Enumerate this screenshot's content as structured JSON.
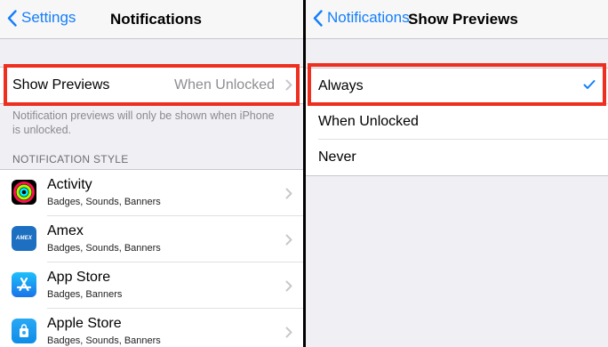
{
  "left": {
    "nav": {
      "back_label": "Settings",
      "title": "Notifications"
    },
    "show_previews": {
      "label": "Show Previews",
      "value": "When Unlocked"
    },
    "note": "Notification previews will only be shown when iPhone is unlocked.",
    "section_header": "NOTIFICATION STYLE",
    "apps": [
      {
        "name": "Activity",
        "detail": "Badges, Sounds, Banners",
        "icon": "activity-icon"
      },
      {
        "name": "Amex",
        "detail": "Badges, Sounds, Banners",
        "icon": "amex-icon",
        "icon_text": "AMEX"
      },
      {
        "name": "App Store",
        "detail": "Badges, Banners",
        "icon": "app-store-icon"
      },
      {
        "name": "Apple Store",
        "detail": "Badges, Sounds, Banners",
        "icon": "apple-store-icon"
      }
    ]
  },
  "right": {
    "nav": {
      "back_label": "Notifications",
      "title": "Show Previews"
    },
    "options": [
      {
        "label": "Always",
        "selected": true
      },
      {
        "label": "When Unlocked",
        "selected": false
      },
      {
        "label": "Never",
        "selected": false
      }
    ]
  },
  "colors": {
    "accent": "#157efb",
    "highlight": "#ee2e1f",
    "background": "#efeff4"
  }
}
